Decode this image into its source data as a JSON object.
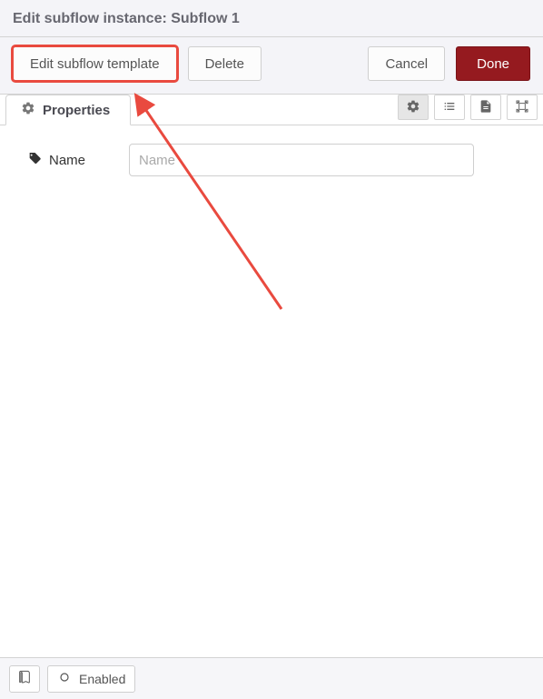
{
  "header": {
    "title": "Edit subflow instance: Subflow 1"
  },
  "actions": {
    "edit_template": "Edit subflow template",
    "delete": "Delete",
    "cancel": "Cancel",
    "done": "Done"
  },
  "tabs": {
    "properties": "Properties"
  },
  "form": {
    "name_label": "Name",
    "name_placeholder": "Name",
    "name_value": ""
  },
  "footer": {
    "enabled": "Enabled"
  },
  "icons": {
    "gear": "gear-icon",
    "list": "list-icon",
    "file": "file-icon",
    "group": "group-select-icon",
    "tag": "tag-icon",
    "book": "book-icon",
    "circle": "circle-icon"
  }
}
